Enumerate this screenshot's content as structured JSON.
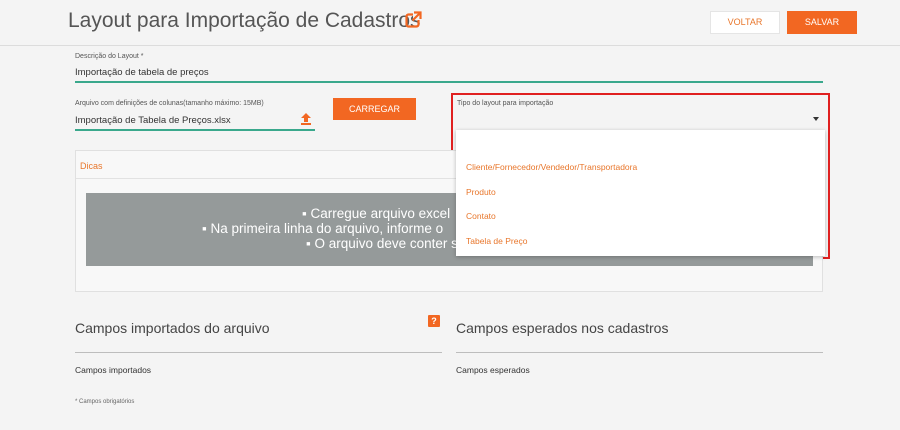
{
  "header": {
    "title": "Layout para Importação de Cadastros",
    "back_label": "VOLTAR",
    "save_label": "SALVAR",
    "external_link_icon": "external-link-icon"
  },
  "form": {
    "descricao_label": "Descrição do Layout *",
    "descricao_value": "Importação de tabela de preços",
    "arquivo_label": "Arquivo com definições de colunas(tamanho máximo: 15MB)",
    "arquivo_value": "Importação de Tabela de Preços.xlsx",
    "upload_icon": "upload-icon",
    "load_label": "CARREGAR",
    "tipo_label": "Tipo do layout para importação",
    "tipo_value": "",
    "tipo_options": [
      "Cliente/Fornecedor/Vendedor/Transportadora",
      "Produto",
      "Contato",
      "Tabela de Preço"
    ]
  },
  "dicas": {
    "title": "Dicas",
    "lines": [
      "▪ Carregue arquivo excel",
      "▪ Na primeira linha do arquivo, informe o",
      "▪ O arquivo deve conter s"
    ]
  },
  "campos_importados": {
    "title": "Campos importados do arquivo",
    "subtitle": "Campos importados",
    "help_label": "?"
  },
  "campos_esperados": {
    "title": "Campos esperados nos cadastros",
    "subtitle": "Campos esperados"
  },
  "footnote": "* Campos obrigatórios",
  "colors": {
    "accent": "#f26722",
    "accent_text": "#e8762b",
    "underline": "#3aa88c",
    "highlight_border": "#e02020",
    "banner": "#959a9a"
  }
}
